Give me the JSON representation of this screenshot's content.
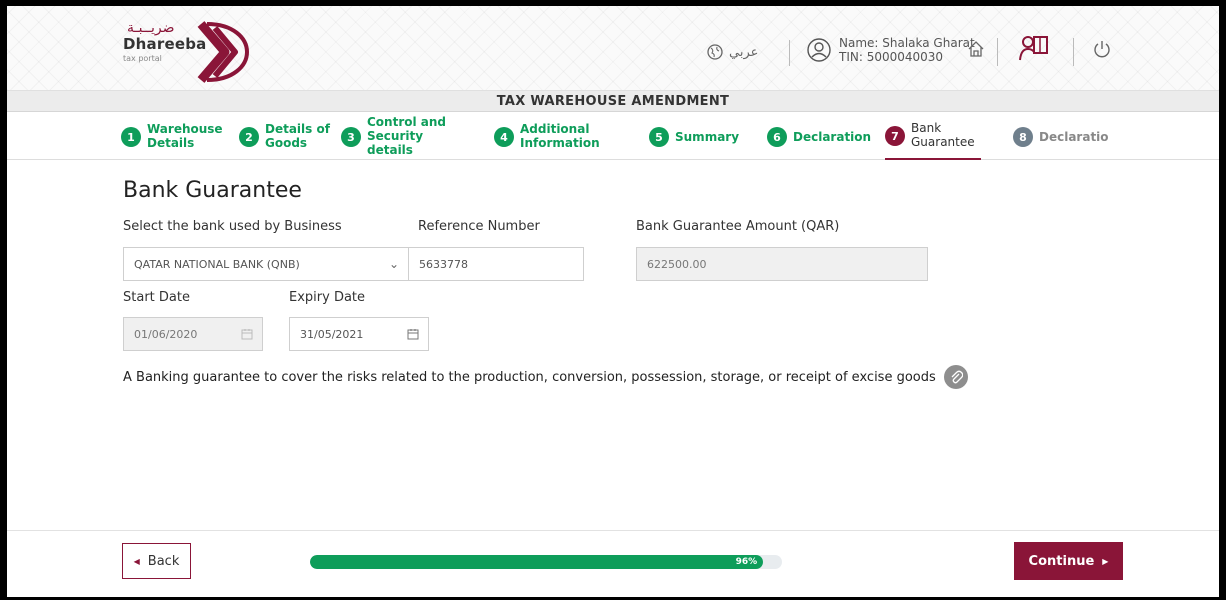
{
  "header": {
    "logo_arabic": "ضريــبـة",
    "logo_name": "Dhareeba",
    "logo_sub": "tax portal",
    "lang_label": "عربي",
    "user_name": "Name: Shalaka Gharat",
    "user_tin": "TIN: 5000040030"
  },
  "title_bar": "TAX WAREHOUSE AMENDMENT",
  "steps": [
    {
      "num": "1",
      "label": "Warehouse Details",
      "state": "done"
    },
    {
      "num": "2",
      "label": "Details of Goods",
      "state": "done"
    },
    {
      "num": "3",
      "label": "Control and Security details",
      "state": "done"
    },
    {
      "num": "4",
      "label": "Additional Information",
      "state": "done"
    },
    {
      "num": "5",
      "label": "Summary",
      "state": "done"
    },
    {
      "num": "6",
      "label": "Declaration",
      "state": "done"
    },
    {
      "num": "7",
      "label": "Bank Guarantee",
      "state": "active"
    },
    {
      "num": "8",
      "label": "Declaratio",
      "state": "pending"
    }
  ],
  "page_title": "Bank Guarantee",
  "form": {
    "bank_label": "Select the bank used by Business",
    "bank_value": "QATAR NATIONAL BANK (QNB)",
    "ref_label": "Reference Number",
    "ref_value": "5633778",
    "amount_label": "Bank Guarantee Amount (QAR)",
    "amount_value": "622500.00",
    "start_label": "Start Date",
    "start_value": "01/06/2020",
    "expiry_label": "Expiry Date",
    "expiry_value": "31/05/2021"
  },
  "info_text": "A Banking guarantee to cover the risks related to the production, conversion, possession, storage, or receipt of excise goods",
  "footer": {
    "back_label": "Back",
    "continue_label": "Continue",
    "progress_text": "96%",
    "progress_fraction": 0.96
  },
  "colors": {
    "brand": "#8a1538",
    "success": "#0e9d5a",
    "pending": "#6f7f8c"
  }
}
